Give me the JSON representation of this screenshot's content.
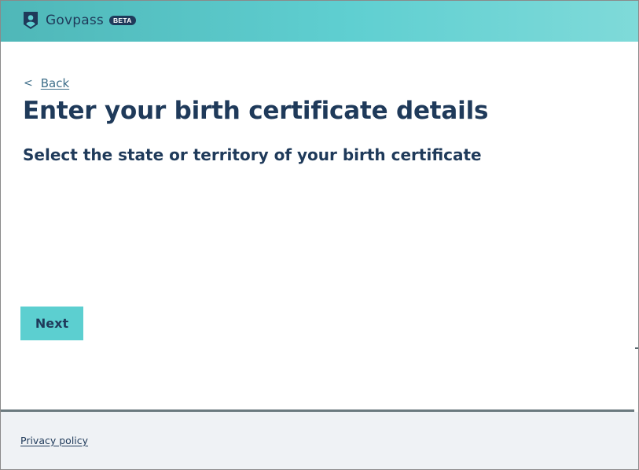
{
  "header": {
    "brand_name": "Govpass",
    "badge": "BETA",
    "logo_icon": "shield-person-icon"
  },
  "navigation": {
    "back_chevron": "<",
    "back_label": "Back"
  },
  "main": {
    "title": "Enter your birth certificate details",
    "subtitle": "Select the state or territory of your birth certificate",
    "next_label": "Next"
  },
  "footer": {
    "privacy_label": "Privacy policy"
  },
  "colors": {
    "header_gradient_start": "#4fb7b8",
    "header_gradient_end": "#7fdad9",
    "primary_text": "#1f3a5a",
    "link": "#3f6f8a",
    "button": "#5ccfd0",
    "footer_bg": "#eff2f5"
  }
}
